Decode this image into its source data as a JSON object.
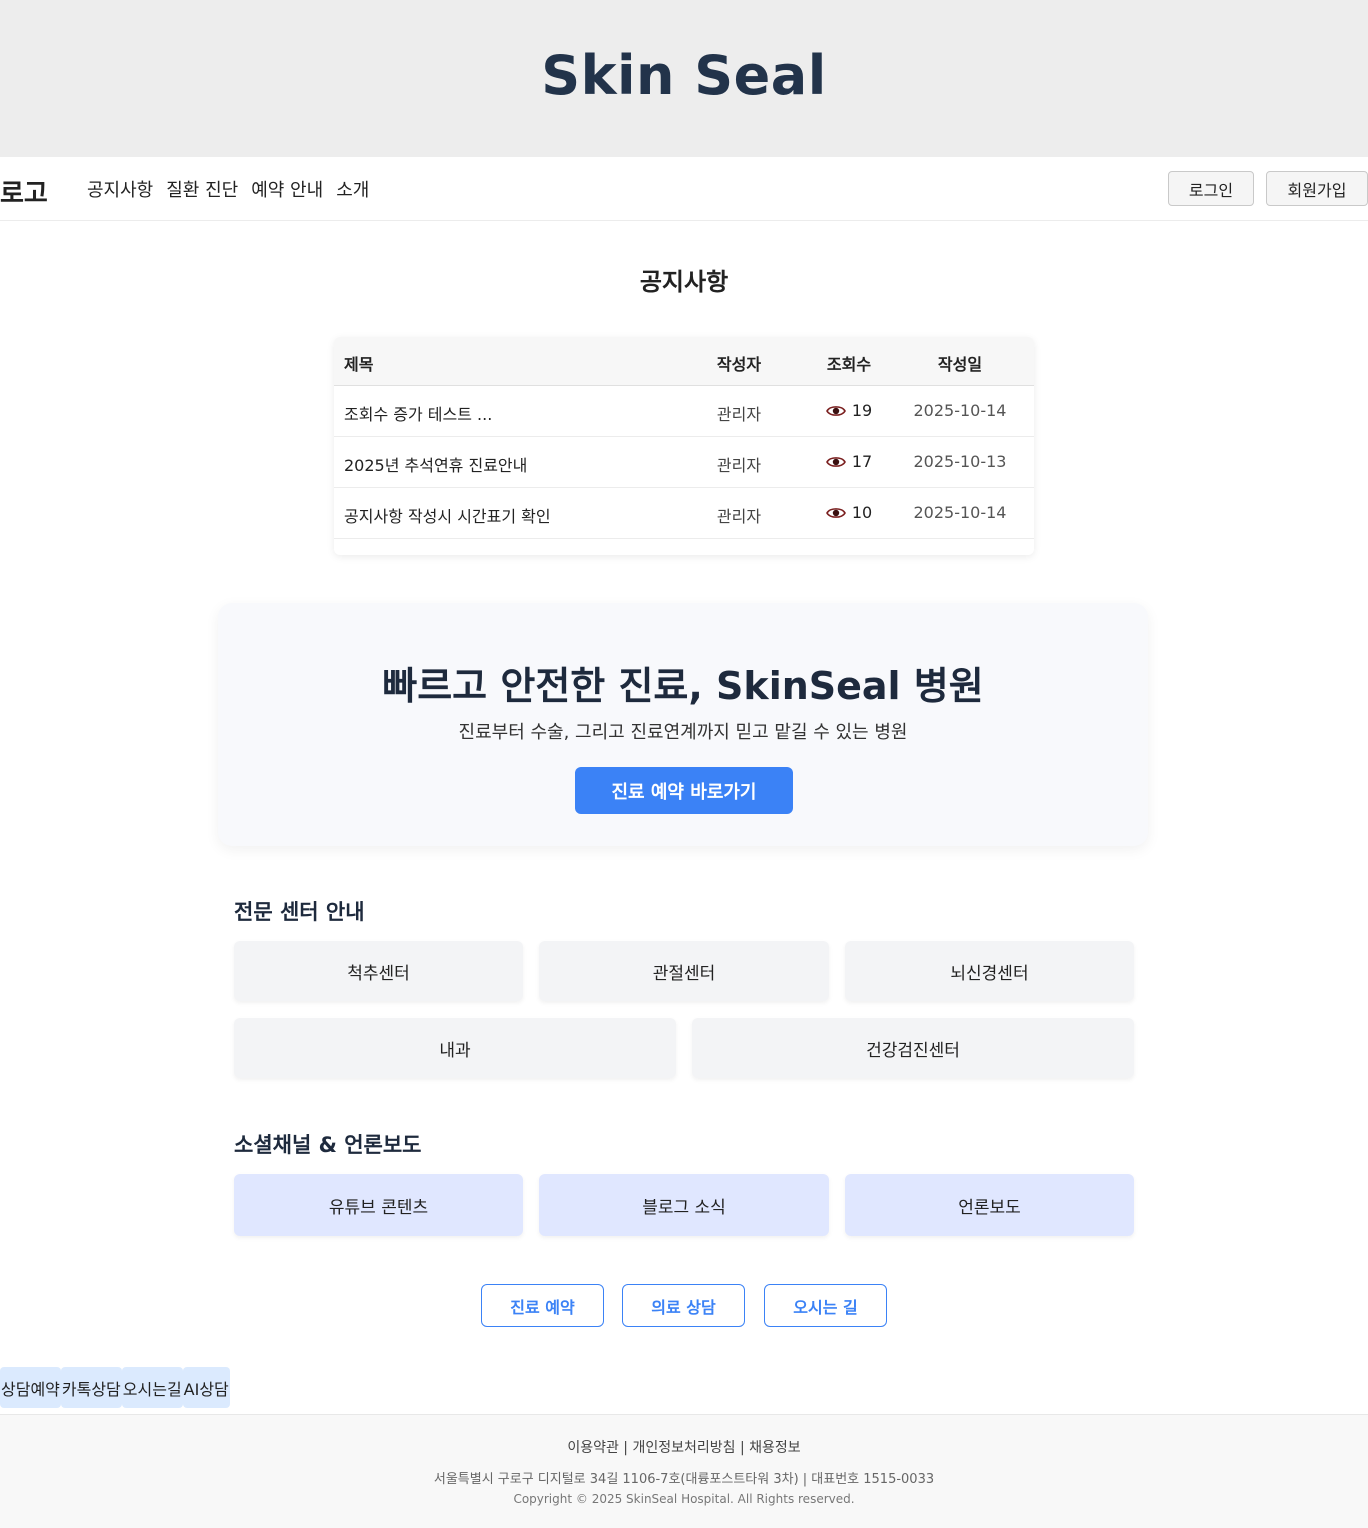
{
  "site": {
    "title": "Skin Seal"
  },
  "nav": {
    "logo": "로고",
    "links": [
      "공지사항",
      "질환 진단",
      "예약 안내",
      "소개"
    ],
    "login": "로그인",
    "signup": "회원가입"
  },
  "notice": {
    "title": "공지사항",
    "headers": {
      "title": "제목",
      "author": "작성자",
      "views": "조회수",
      "date": "작성일"
    },
    "rows": [
      {
        "title": "조회수 증가 테스트 ...",
        "author": "관리자",
        "views": "19",
        "date": "2025-10-14"
      },
      {
        "title": "2025년 추석연휴 진료안내",
        "author": "관리자",
        "views": "17",
        "date": "2025-10-13"
      },
      {
        "title": "공지사항 작성시 시간표기 확인",
        "author": "관리자",
        "views": "10",
        "date": "2025-10-14"
      }
    ]
  },
  "hero": {
    "title": "빠르고 안전한 진료, SkinSeal 병원",
    "subtitle": "진료부터 수술, 그리고 진료연계까지 믿고 맡길 수 있는 병원",
    "button": "진료 예약 바로가기"
  },
  "centers": {
    "title": "전문 센터 안내",
    "items": [
      "척추센터",
      "관절센터",
      "뇌신경센터",
      "내과",
      "건강검진센터"
    ]
  },
  "social": {
    "title": "소셜채널 & 언론보도",
    "items": [
      "유튜브 콘텐츠",
      "블로그 소식",
      "언론보도"
    ]
  },
  "quick_links": [
    "진료 예약",
    "의료 상담",
    "오시는 길"
  ],
  "floating": [
    "상담예약",
    "카톡상담",
    "오시는길",
    "AI상담"
  ],
  "footer": {
    "links": [
      "이용약관",
      "개인정보처리방침",
      "채용정보"
    ],
    "separator": " | ",
    "address": "서울특별시 구로구 디지털로 34길 1106-7호(대륭포스트타워 3차) | 대표번호 1515-0033",
    "copyright": "Copyright © 2025 SkinSeal Hospital. All Rights reserved."
  },
  "colors": {
    "accent": "#3b82f6",
    "heading": "#1e2a3d",
    "social_bg": "#e0e7ff",
    "floating_bg": "#dbeafe"
  }
}
